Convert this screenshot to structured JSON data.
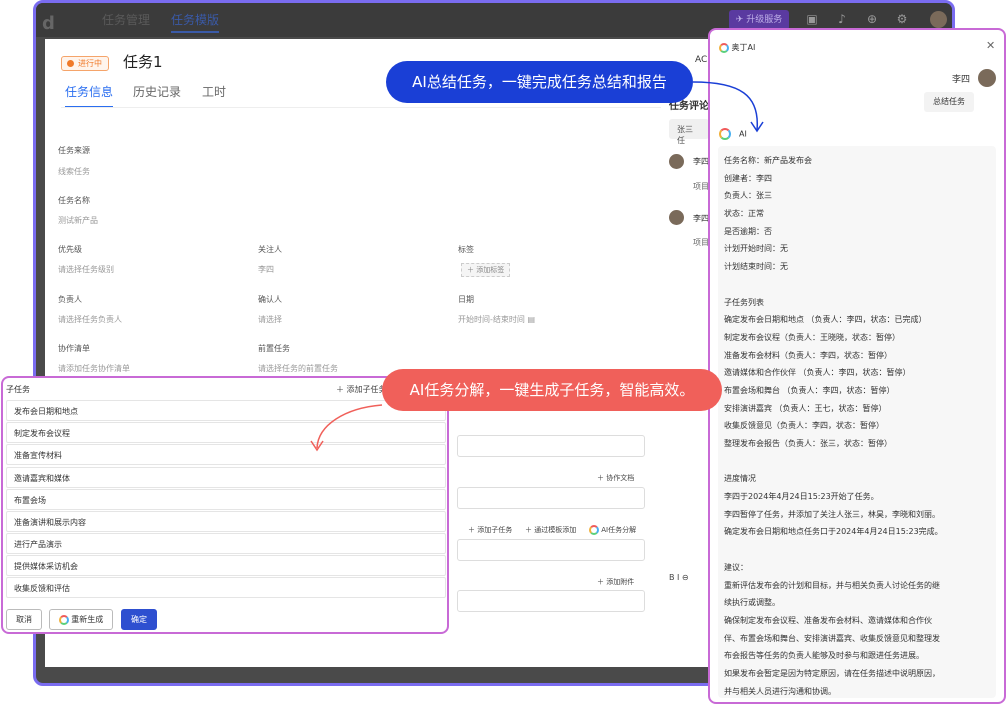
{
  "topbar": {
    "nav": [
      "任务管理",
      "任务模版"
    ],
    "upgrade_label": "升级服务"
  },
  "modal": {
    "status": "进行中",
    "title": "任务1",
    "ac_text": "AC",
    "tabs": [
      "任务信息",
      "历史记录",
      "工时"
    ],
    "fields": {
      "source": {
        "label": "任务来源",
        "value": "线索任务"
      },
      "name": {
        "label": "任务名称",
        "value": "测试新产品"
      },
      "priority": {
        "label": "优先级",
        "value": "请选择任务级别"
      },
      "follower": {
        "label": "关注人",
        "value": "李四"
      },
      "tags": {
        "label": "标签",
        "value": "添加标签"
      },
      "owner": {
        "label": "负责人",
        "value": "请选择任务负责人"
      },
      "confirmer": {
        "label": "确认人",
        "value": "请选择"
      },
      "date": {
        "label": "日期",
        "value": "开始时间-结束时间"
      },
      "collab": {
        "label": "协作清单",
        "value": "请添加任务协作清单"
      },
      "predecessor": {
        "label": "前置任务",
        "value": "请选择任务的前置任务"
      }
    },
    "links": {
      "collab_doc": "协作文档",
      "add_subtask": "添加子任务",
      "from_template": "通过模板添加",
      "ai_decompose": "AI任务分解",
      "add_attachment": "添加附件"
    },
    "comments": {
      "title": "任务评论",
      "input": "张三 任",
      "items": [
        {
          "name": "李四",
          "text": "项目"
        },
        {
          "name": "李四",
          "text": "项目"
        }
      ]
    },
    "editor_toolbar": "B  I  ⊖"
  },
  "subtask_panel": {
    "header": "子任务",
    "add_label": "添加子任务",
    "items": [
      "发布会日期和地点",
      "制定发布会议程",
      "准备宣传材料",
      "邀请嘉宾和媒体",
      "布置会场",
      "准备演讲和展示内容",
      "进行产品演示",
      "提供媒体采访机会",
      "收集反馈和评估"
    ],
    "cancel": "取消",
    "regenerate": "重新生成",
    "confirm": "确定"
  },
  "ai_panel": {
    "header": "奥丁AI",
    "user_name": "李四",
    "user_message": "总结任务",
    "ai_label": "AI",
    "response_lines": [
      "任务名称：新产品发布会",
      "创建者：李四",
      "负责人：张三",
      "状态：正常",
      "是否逾期：否",
      "计划开始时间：无",
      "计划结束时间：无",
      "",
      "子任务列表",
      "确定发布会日期和地点 （负责人：李四，状态：已完成）",
      "制定发布会议程（负责人：王晓晓，状态：暂停）",
      "准备发布会材料（负责人：李四，状态：暂停）",
      "邀请媒体和合作伙伴 （负责人：李四，状态：暂停）",
      "布置会场和舞台 （负责人：李四，状态：暂停）",
      "安排演讲嘉宾 （负责人：王七，状态：暂停）",
      "收集反馈意见（负责人：李四，状态：暂停）",
      "整理发布会报告（负责人：张三，状态：暂停）",
      "",
      "进度情况",
      "李四于2024年4月24日15:23开始了任务。",
      "李四暂停了任务，并添加了关注人张三，林昊，李晓和刘丽。",
      "确定发布会日期和地点任务口于2024年4月24日15:23完成。",
      "",
      "建议：",
      "重新评估发布会的计划和目标，并与相关负责人讨论任务的继",
      "续执行或调整。",
      "确保制定发布会议程、准备发布会材料、邀请媒体和合作伙",
      "伴、布置会场和舞台、安排演讲嘉宾、收集反馈意见和整理发",
      "布会报告等任务的负责人能够及时参与和跟进任务进展。",
      "如果发布会暂定是因为特定原因，请在任务描述中说明原因，",
      "并与相关人员进行沟通和协调。"
    ]
  },
  "callouts": {
    "summary": "AI总结任务，一键完成任务总结和报告",
    "decompose": "AI任务分解，一键生成子任务，智能高效。"
  },
  "colors": {
    "frame_border": "#7a6cf0",
    "panel_border": "#c86ad6",
    "primary": "#2e4fd0",
    "callout_blue": "#1a3fd6",
    "callout_red": "#f0605a",
    "status_orange": "#f07a2a"
  }
}
